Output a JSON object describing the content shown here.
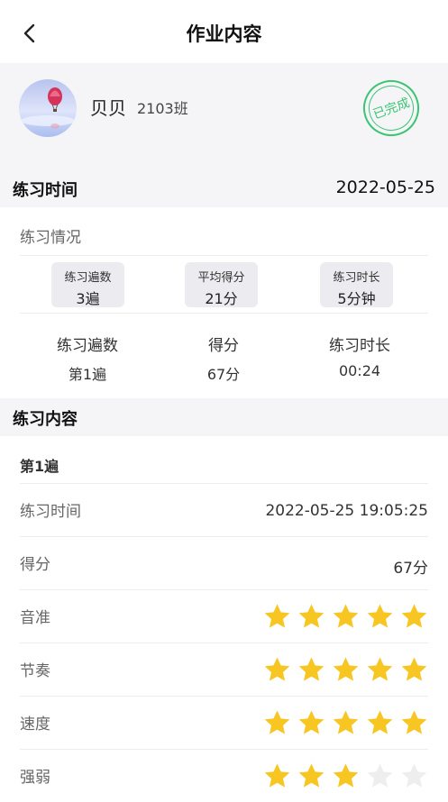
{
  "nav": {
    "title": "作业内容",
    "back_icon": "chevron-left-icon"
  },
  "profile": {
    "name": "贝贝",
    "class": "2103班",
    "stamp": "已完成",
    "stamp_color": "#3cc472"
  },
  "practice_time": {
    "label": "练习时间",
    "date": "2022-05-25"
  },
  "practice_status": {
    "label": "练习情况",
    "chips": [
      {
        "title": "练习遍数",
        "value": "3遍"
      },
      {
        "title": "平均得分",
        "value": "21分"
      },
      {
        "title": "练习时长",
        "value": "5分钟"
      }
    ],
    "stats": [
      {
        "label": "练习遍数",
        "value": "第1遍"
      },
      {
        "label": "得分",
        "value": "67分"
      },
      {
        "label": "练习时长",
        "value": "00:24"
      }
    ]
  },
  "content": {
    "label": "练习内容",
    "round": "第1遍",
    "time": {
      "label": "练习时间",
      "value": "2022-05-25 19:05:25"
    },
    "score": {
      "label": "得分",
      "value": "67分"
    },
    "ratings": [
      {
        "label": "音准",
        "stars": 5
      },
      {
        "label": "节奏",
        "stars": 5
      },
      {
        "label": "速度",
        "stars": 5
      },
      {
        "label": "强弱",
        "stars": 3
      }
    ],
    "max_stars": 5,
    "star_on_color": "#f7c623",
    "star_off_color": "#eeeeee"
  }
}
